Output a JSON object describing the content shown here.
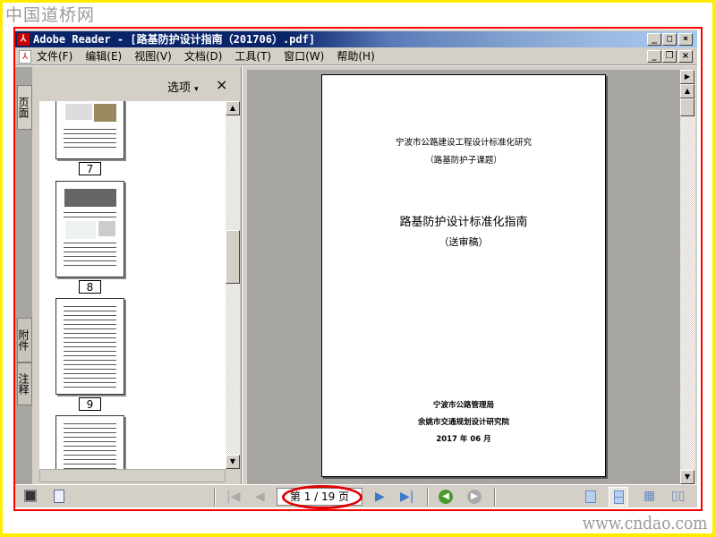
{
  "watermarks": {
    "top_left": "中国道桥网",
    "bottom_right": "www.cndao.com"
  },
  "window": {
    "title": "Adobe Reader - [路基防护设计指南（201706）.pdf]"
  },
  "menu": [
    "文件(F)",
    "编辑(E)",
    "视图(V)",
    "文档(D)",
    "工具(T)",
    "窗口(W)",
    "帮助(H)"
  ],
  "side_tabs": [
    "页面",
    "附件",
    "注释"
  ],
  "panel": {
    "options_label": "选项",
    "options_arrow": "▾",
    "close": "×"
  },
  "thumbnails": [
    "7",
    "8",
    "9",
    ""
  ],
  "document": {
    "line1": "宁波市公路建设工程设计标准化研究",
    "line2": "（路基防护子课题）",
    "title": "路基防护设计标准化指南",
    "subtitle": "（送审稿）",
    "org1": "宁波市公路管理局",
    "org2": "余姚市交通规划设计研究院",
    "date": "2017 年 06 月"
  },
  "status": {
    "page_field": "第 1 / 19 页"
  },
  "colors": {
    "highlight_ellipse": "#e00000",
    "frame": "#ff0000",
    "border": "#ffec00"
  }
}
